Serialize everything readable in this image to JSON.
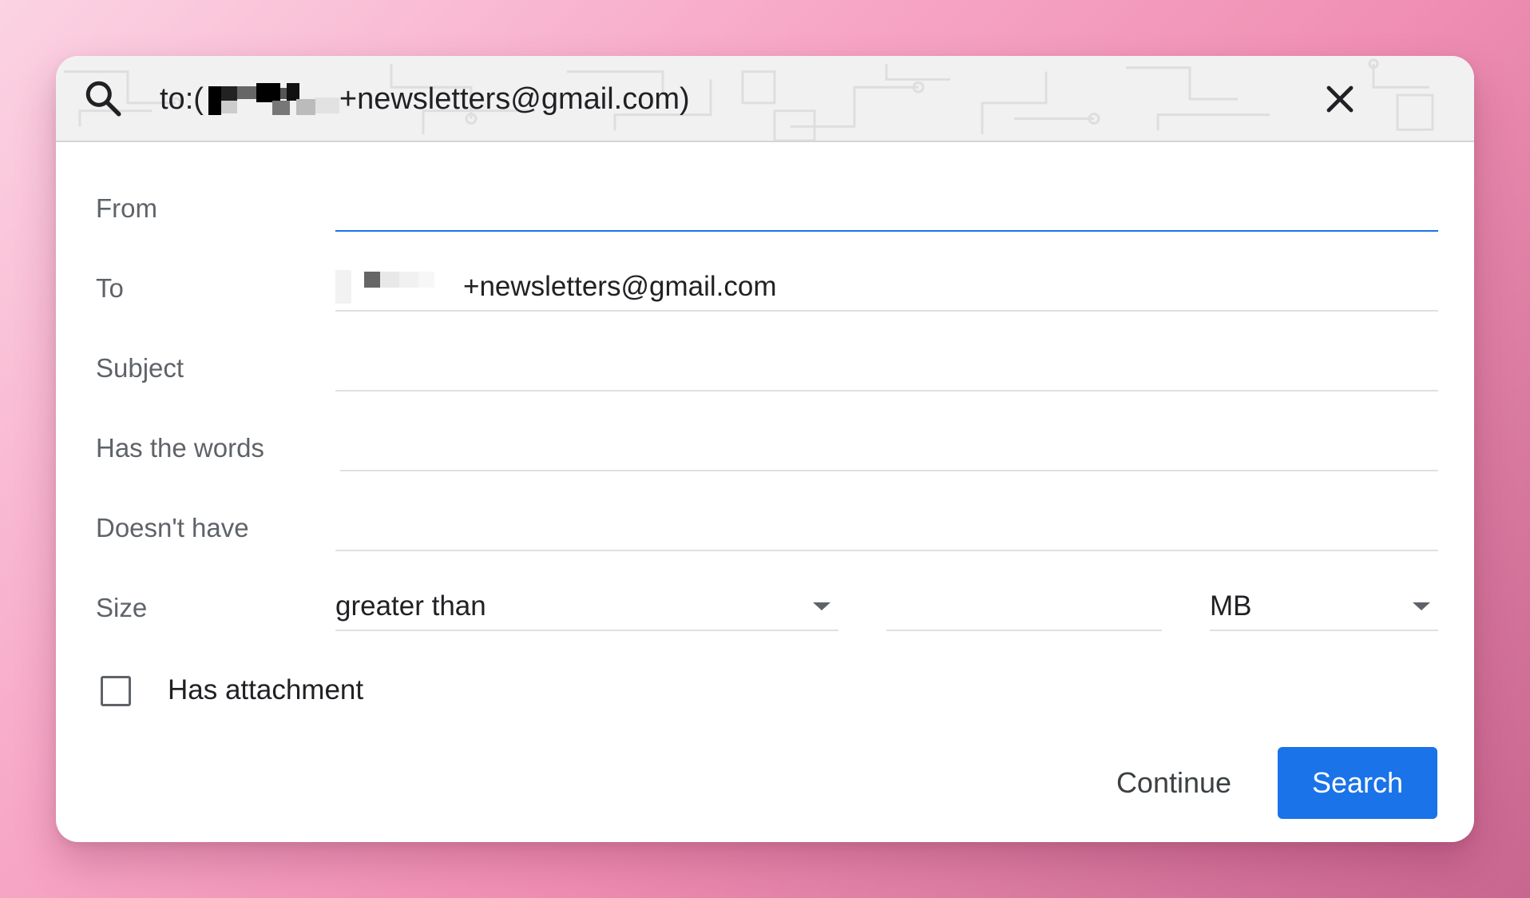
{
  "search_bar": {
    "query_prefix": "to:(",
    "query_suffix": "+newsletters@gmail.com)",
    "search_icon": "search-icon",
    "close_icon": "close-icon"
  },
  "form": {
    "from": {
      "label": "From",
      "value": ""
    },
    "to": {
      "label": "To",
      "value": "+newsletters@gmail.com"
    },
    "subject": {
      "label": "Subject",
      "value": ""
    },
    "has_words": {
      "label": "Has the words",
      "value": ""
    },
    "doesnt_have": {
      "label": "Doesn't have",
      "value": ""
    },
    "size": {
      "label": "Size",
      "comparator": "greater than",
      "amount": "",
      "unit": "MB"
    },
    "has_attachment": {
      "label": "Has attachment",
      "checked": false
    }
  },
  "actions": {
    "continue_label": "Continue",
    "search_label": "Search"
  },
  "colors": {
    "accent": "#1a73e8",
    "label_text": "#5f6368",
    "primary_text": "#202124"
  }
}
